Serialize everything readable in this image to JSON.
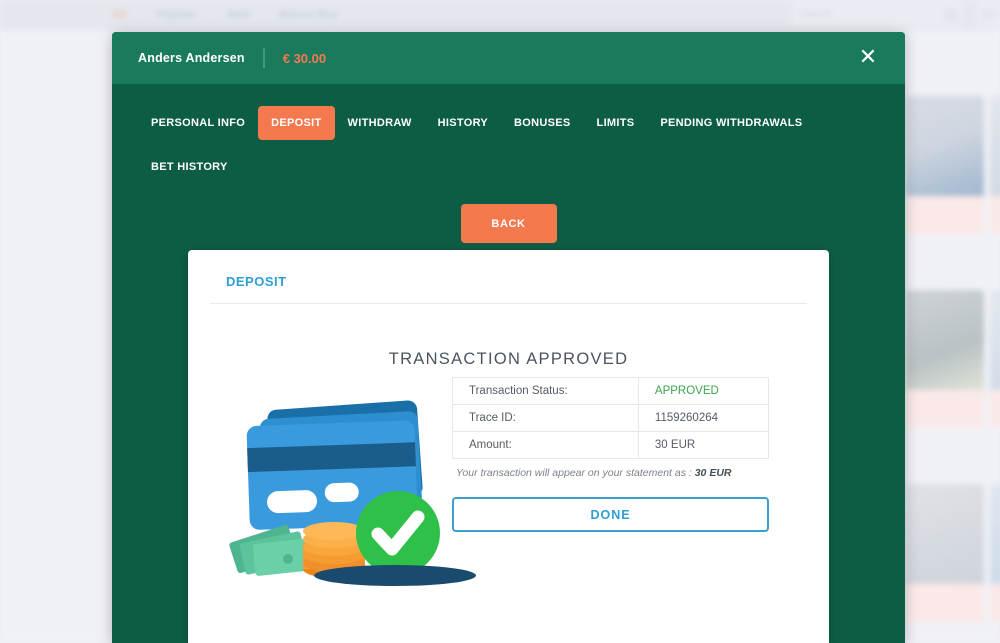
{
  "background": {
    "nav_items": [
      {
        "label": "All",
        "accent": true
      },
      {
        "label": "Popular",
        "accent": false
      },
      {
        "label": "New",
        "accent": false
      },
      {
        "label": "Bonus Buy",
        "accent": false
      }
    ],
    "search": {
      "placeholder": "Search",
      "icon": "search-icon"
    },
    "go_label": "Go"
  },
  "modal": {
    "header": {
      "user_name": "Anders Andersen",
      "balance": "€ 30.00",
      "close_icon": "close-icon"
    },
    "tabs_row1": [
      {
        "label": "PERSONAL INFO",
        "active": false
      },
      {
        "label": "DEPOSIT",
        "active": true
      },
      {
        "label": "WITHDRAW",
        "active": false
      },
      {
        "label": "HISTORY",
        "active": false
      },
      {
        "label": "BONUSES",
        "active": false
      },
      {
        "label": "LIMITS",
        "active": false
      },
      {
        "label": "PENDING WITHDRAWALS",
        "active": false
      }
    ],
    "tabs_row2": [
      {
        "label": "BET HISTORY",
        "active": false
      }
    ],
    "back_label": "BACK"
  },
  "panel": {
    "title": "DEPOSIT",
    "heading": "TRANSACTION APPROVED",
    "illustration": "credit-card-approved-illustration",
    "table": {
      "rows": [
        {
          "label": "Transaction Status:",
          "value": "APPROVED",
          "status": true
        },
        {
          "label": "Trace ID:",
          "value": "1159260264",
          "status": false
        },
        {
          "label": "Amount:",
          "value": "30 EUR",
          "status": false
        }
      ]
    },
    "statement_prefix": "Your transaction will appear on your statement as : ",
    "statement_amount": "30 EUR",
    "done_label": "DONE"
  },
  "colors": {
    "modal_header_green": "#1a7a5e",
    "modal_body_green": "#0d5c44",
    "accent_orange": "#f4794e",
    "link_blue": "#2e9fd4",
    "approved_green": "#3fa34d"
  }
}
